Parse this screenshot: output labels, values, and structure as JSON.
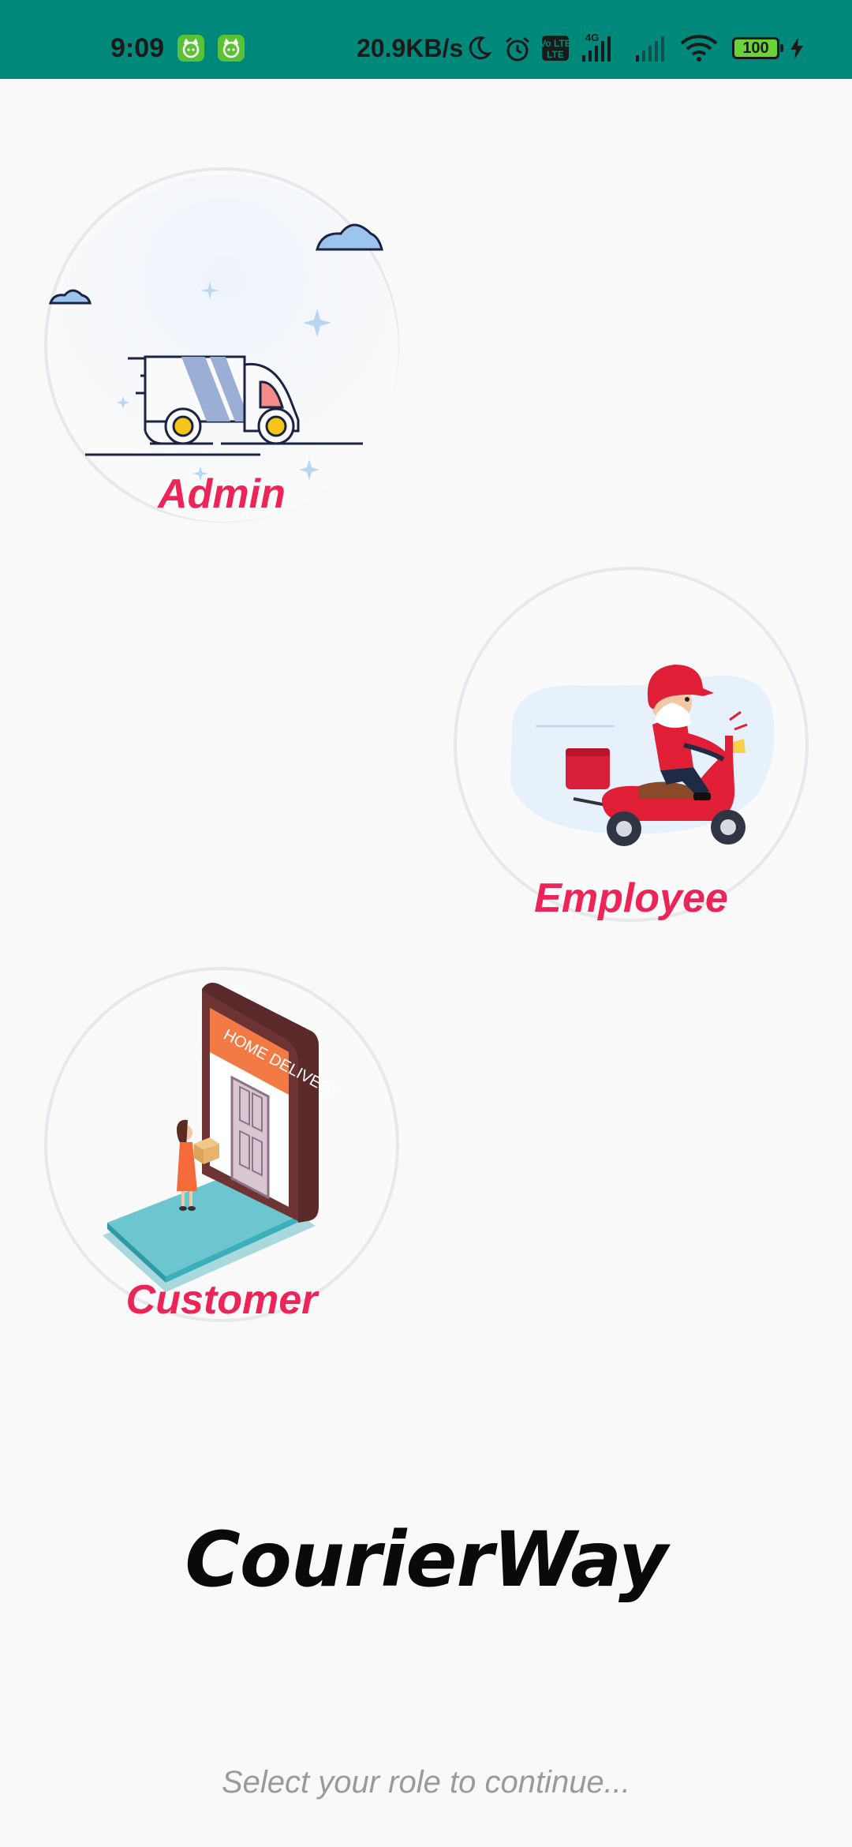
{
  "status_bar": {
    "time": "9:09",
    "network_speed": "20.9KB/s",
    "battery_level": "100",
    "network_type": "4G",
    "volte_label": "Vo LTE",
    "icons": [
      "cat-app-icon",
      "cat-app-icon",
      "moon-icon",
      "alarm-icon",
      "volte-icon",
      "signal-icon",
      "signal-icon",
      "wifi-icon",
      "battery-icon",
      "charging-icon"
    ],
    "background_color": "#00897b"
  },
  "roles": [
    {
      "label": "Admin",
      "illustration": "delivery-truck-icon"
    },
    {
      "label": "Employee",
      "illustration": "scooter-rider-icon"
    },
    {
      "label": "Customer",
      "illustration": "phone-home-delivery-icon",
      "illustration_text": "HOME DELIVERY"
    }
  ],
  "brand": {
    "title": "CourierWay"
  },
  "hint": {
    "text": "Select your role to continue..."
  },
  "accent_color": "#ec2457"
}
